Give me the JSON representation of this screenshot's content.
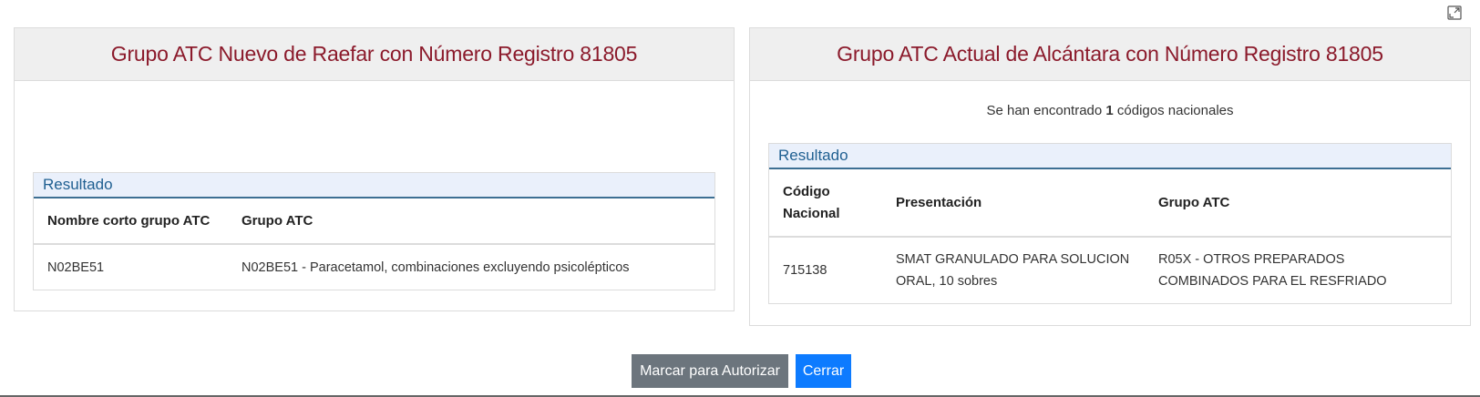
{
  "left_panel": {
    "title": "Grupo ATC Nuevo de Raefar con Número Registro 81805",
    "result_label": "Resultado",
    "columns": [
      "Nombre corto grupo ATC",
      "Grupo ATC"
    ],
    "rows": [
      [
        "N02BE51",
        "N02BE51 - Paracetamol, combinaciones excluyendo psicolépticos"
      ]
    ]
  },
  "right_panel": {
    "title": "Grupo ATC Actual de Alcántara con Número Registro 81805",
    "found_prefix": "Se han encontrado ",
    "found_count": "1",
    "found_suffix": " códigos nacionales",
    "result_label": "Resultado",
    "columns": [
      "Código Nacional",
      "Presentación",
      "Grupo ATC"
    ],
    "rows": [
      [
        "715138",
        "SMAT GRANULADO PARA SOLUCION ORAL, 10 sobres",
        "R05X - OTROS PREPARADOS COMBINADOS PARA EL RESFRIADO"
      ]
    ]
  },
  "buttons": {
    "mark_label": "Marcar para Autorizar",
    "close_label": "Cerrar"
  },
  "icons": {
    "expand": "expand-icon"
  }
}
